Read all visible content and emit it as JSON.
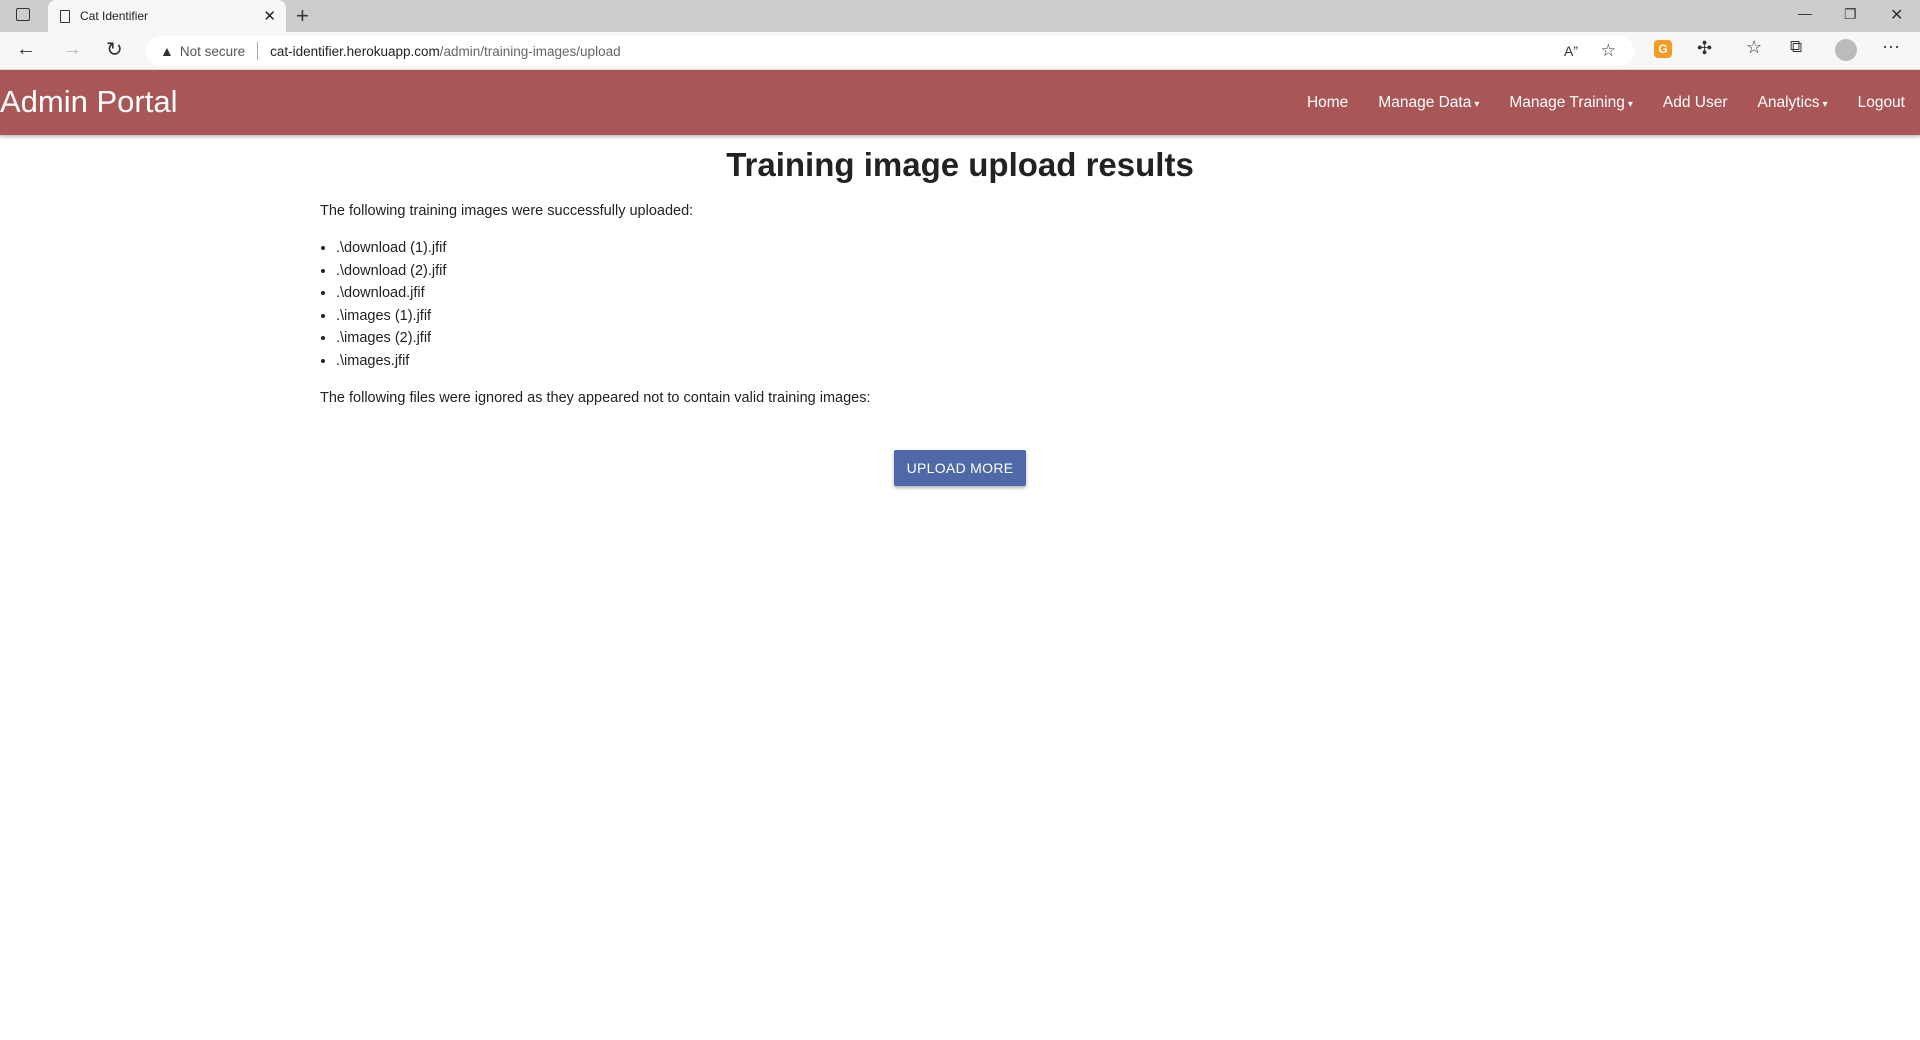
{
  "browser": {
    "tab_title": "Cat Identifier",
    "security_label": "Not secure",
    "url_host": "cat-identifier.herokuapp.com",
    "url_path": "/admin/training-images/upload"
  },
  "navbar": {
    "brand": "Admin Portal",
    "items": [
      {
        "label": "Home"
      },
      {
        "label": "Manage Data",
        "caret": "▾"
      },
      {
        "label": "Manage Training",
        "caret": "▾"
      },
      {
        "label": "Add User"
      },
      {
        "label": "Analytics",
        "caret": "▾"
      },
      {
        "label": "Logout"
      }
    ]
  },
  "main": {
    "title": "Training image upload results",
    "success_text": "The following training images were successfully uploaded:",
    "uploaded": [
      ".\\download (1).jfif",
      ".\\download (2).jfif",
      ".\\download.jfif",
      ".\\images (1).jfif",
      ".\\images (2).jfif",
      ".\\images.jfif"
    ],
    "ignored_text": "The following files were ignored as they appeared not to contain valid training images:",
    "upload_more": "UPLOAD MORE"
  },
  "colors": {
    "navbar": "#a85656",
    "button": "#4f69a8"
  }
}
